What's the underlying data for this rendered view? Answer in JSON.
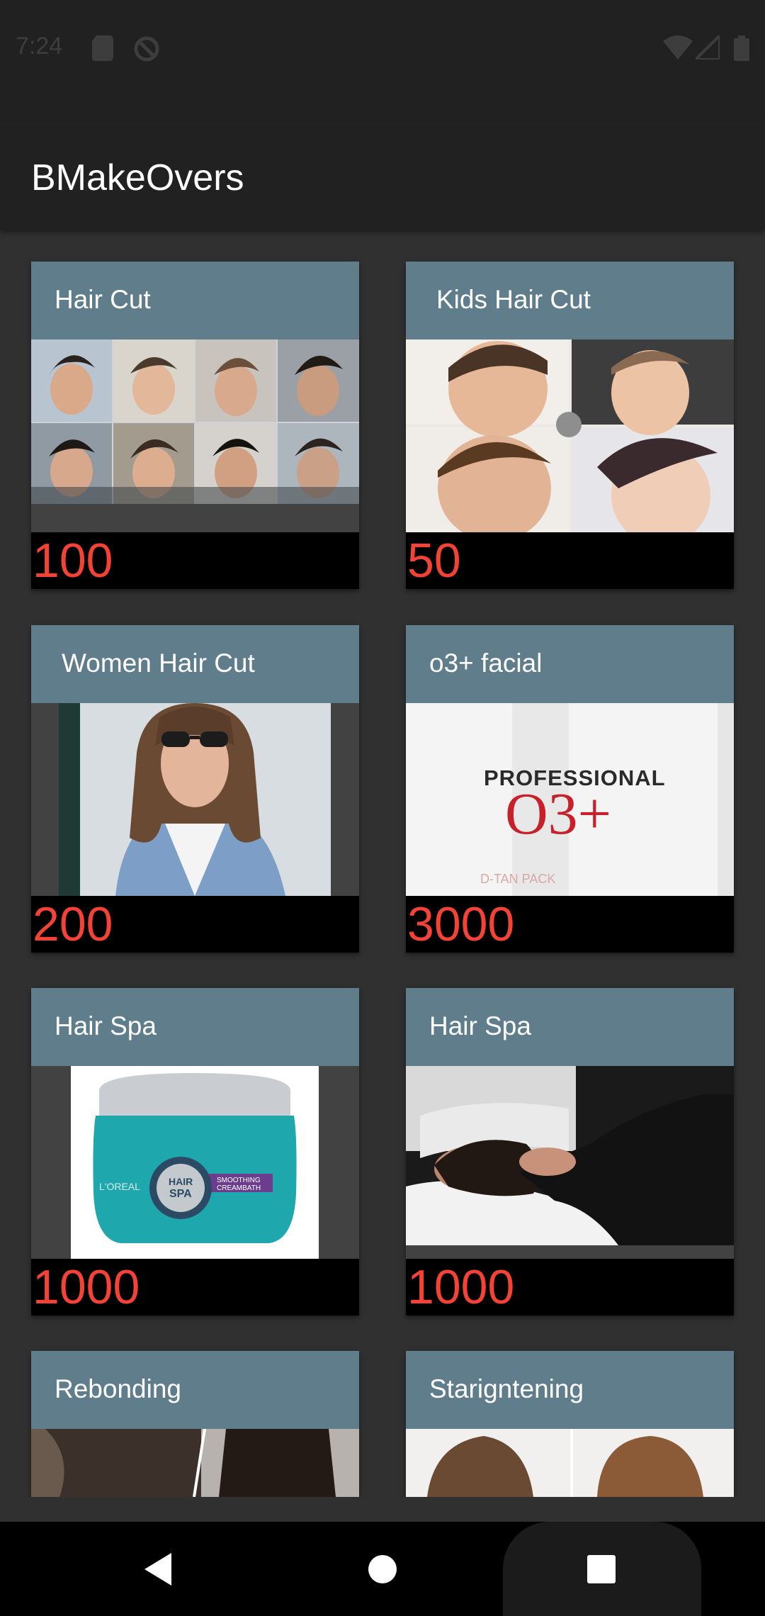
{
  "status_bar": {
    "time": "7:24",
    "icons": [
      "sd-card-icon",
      "no-disturb-icon",
      "wifi-icon",
      "signal-icon",
      "battery-icon"
    ]
  },
  "app_bar": {
    "title": "BMakeOvers"
  },
  "services": [
    {
      "title": "Hair Cut",
      "price": "100",
      "image": "men-haircut-collage"
    },
    {
      "title": "Kids Hair Cut",
      "price": "50",
      "image": "kids-haircut-collage"
    },
    {
      "title": "Women Hair Cut",
      "price": "200",
      "image": "woman-bob-haircut"
    },
    {
      "title": "o3+ facial",
      "price": "3000",
      "image": "o3-plus-product"
    },
    {
      "title": "Hair Spa",
      "price": "1000",
      "image": "loreal-hair-spa-jar"
    },
    {
      "title": "Hair Spa",
      "price": "1000",
      "image": "hair-wash-salon"
    },
    {
      "title": "Rebonding",
      "price": "",
      "image": "rebonding-before-after"
    },
    {
      "title": "Starigntening",
      "price": "",
      "image": "straightening-before-after"
    }
  ],
  "o3_product": {
    "brand": "PROFESSIONAL",
    "logo": "O3+",
    "sub": "D-TAN PACK"
  },
  "spa_jar": {
    "brand": "L'OREAL",
    "badge_line1": "HAIR",
    "badge_line2": "SPA",
    "label": "SMOOTHING CREAMBATH"
  },
  "nav_bar": {
    "buttons": [
      "back-icon",
      "home-icon",
      "recents-icon"
    ]
  },
  "colors": {
    "background": "#303030",
    "app_bar": "#212121",
    "card_header": "#607d8b",
    "price_text": "#f44336"
  }
}
